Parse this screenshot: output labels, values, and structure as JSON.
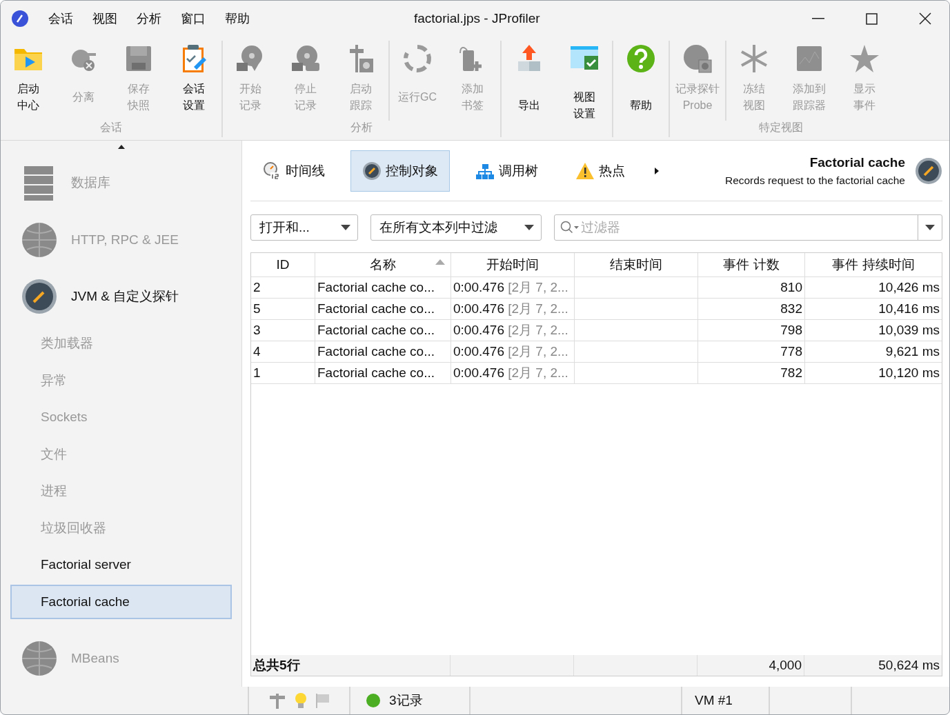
{
  "window": {
    "title": "factorial.jps - JProfiler"
  },
  "menu": [
    "会话",
    "视图",
    "分析",
    "窗口",
    "帮助"
  ],
  "ribbon": [
    {
      "label": "会话",
      "sections": [
        [
          {
            "lines": [
              "启动",
              "中心"
            ],
            "disabled": false
          },
          {
            "lines": [
              "分离"
            ],
            "disabled": true
          },
          {
            "lines": [
              "保存",
              "快照"
            ],
            "disabled": true
          },
          {
            "lines": [
              "会话",
              "设置"
            ],
            "disabled": false
          }
        ]
      ]
    },
    {
      "label": "分析",
      "sections": [
        [
          {
            "lines": [
              "开始",
              "记录"
            ],
            "disabled": true
          },
          {
            "lines": [
              "停止",
              "记录"
            ],
            "disabled": true
          },
          {
            "lines": [
              "启动",
              "跟踪"
            ],
            "disabled": true
          }
        ],
        [
          {
            "lines": [
              "运行GC"
            ],
            "disabled": true
          },
          {
            "lines": [
              "添加",
              "书签"
            ],
            "disabled": true
          }
        ]
      ]
    },
    {
      "sections": [
        [
          {
            "lines": [
              "导出"
            ],
            "disabled": false
          },
          {
            "lines": [
              "视图",
              "设置"
            ],
            "disabled": false
          }
        ]
      ]
    },
    {
      "sections": [
        [
          {
            "lines": [
              "帮助"
            ],
            "disabled": false
          }
        ]
      ]
    },
    {
      "label": "特定视图",
      "sections": [
        [
          {
            "lines": [
              "记录探针",
              "Probe"
            ],
            "disabled": true
          }
        ],
        [
          {
            "lines": [
              "冻结",
              "视图"
            ],
            "disabled": true
          },
          {
            "lines": [
              "添加到",
              "跟踪器"
            ],
            "disabled": true
          },
          {
            "lines": [
              "显示",
              "事件"
            ],
            "disabled": true
          }
        ]
      ]
    }
  ],
  "sidebar": {
    "items": [
      {
        "kind": "category",
        "label": "数据库",
        "disabled": true,
        "selected": false
      },
      {
        "kind": "category",
        "label": "HTTP, RPC & JEE",
        "disabled": true,
        "selected": false
      },
      {
        "kind": "category",
        "label": "JVM & 自定义探针",
        "disabled": false,
        "selected": false
      },
      {
        "kind": "sub",
        "label": "类加载器",
        "disabled": true,
        "selected": false
      },
      {
        "kind": "sub",
        "label": "异常",
        "disabled": true,
        "selected": false
      },
      {
        "kind": "sub",
        "label": "Sockets",
        "disabled": true,
        "selected": false
      },
      {
        "kind": "sub",
        "label": "文件",
        "disabled": true,
        "selected": false
      },
      {
        "kind": "sub",
        "label": "进程",
        "disabled": true,
        "selected": false
      },
      {
        "kind": "sub",
        "label": "垃圾回收器",
        "disabled": true,
        "selected": false
      },
      {
        "kind": "sub",
        "label": "Factorial server",
        "disabled": false,
        "selected": false
      },
      {
        "kind": "sub",
        "label": "Factorial cache",
        "disabled": false,
        "selected": true
      },
      {
        "kind": "category",
        "label": "MBeans",
        "disabled": true,
        "selected": false
      }
    ]
  },
  "view_tabs": [
    {
      "label": "时间线",
      "selected": false
    },
    {
      "label": "控制对象",
      "selected": true
    },
    {
      "label": "调用树",
      "selected": false
    },
    {
      "label": "热点",
      "selected": false
    }
  ],
  "probe": {
    "title": "Factorial cache",
    "description": "Records request to the factorial cache"
  },
  "filters": {
    "mode": "打开和...",
    "scope": "在所有文本列中过滤",
    "search_placeholder": "过滤器"
  },
  "table": {
    "columns": [
      {
        "label": "ID",
        "sorted": false
      },
      {
        "label": "名称",
        "sorted": true
      },
      {
        "label": "开始时间",
        "sorted": false
      },
      {
        "label": "结束时间",
        "sorted": false
      },
      {
        "label": "事件 计数",
        "sorted": false
      },
      {
        "label": "事件 持续时间",
        "sorted": false
      }
    ],
    "rows": [
      {
        "id": "2",
        "name": "Factorial cache co...",
        "start_time": "0:00.476",
        "start_date": "[2月 7, 2...",
        "count": "810",
        "duration": "10,426 ms"
      },
      {
        "id": "5",
        "name": "Factorial cache co...",
        "start_time": "0:00.476",
        "start_date": "[2月 7, 2...",
        "count": "832",
        "duration": "10,416 ms"
      },
      {
        "id": "3",
        "name": "Factorial cache co...",
        "start_time": "0:00.476",
        "start_date": "[2月 7, 2...",
        "count": "798",
        "duration": "10,039 ms"
      },
      {
        "id": "4",
        "name": "Factorial cache co...",
        "start_time": "0:00.476",
        "start_date": "[2月 7, 2...",
        "count": "778",
        "duration": "9,621 ms"
      },
      {
        "id": "1",
        "name": "Factorial cache co...",
        "start_time": "0:00.476",
        "start_date": "[2月 7, 2...",
        "count": "782",
        "duration": "10,120 ms"
      }
    ],
    "footer": {
      "label": "总共5行",
      "count": "4,000",
      "duration": "50,624 ms"
    }
  },
  "status_bar": {
    "recordings": "3记录",
    "vm": "VM #1"
  }
}
